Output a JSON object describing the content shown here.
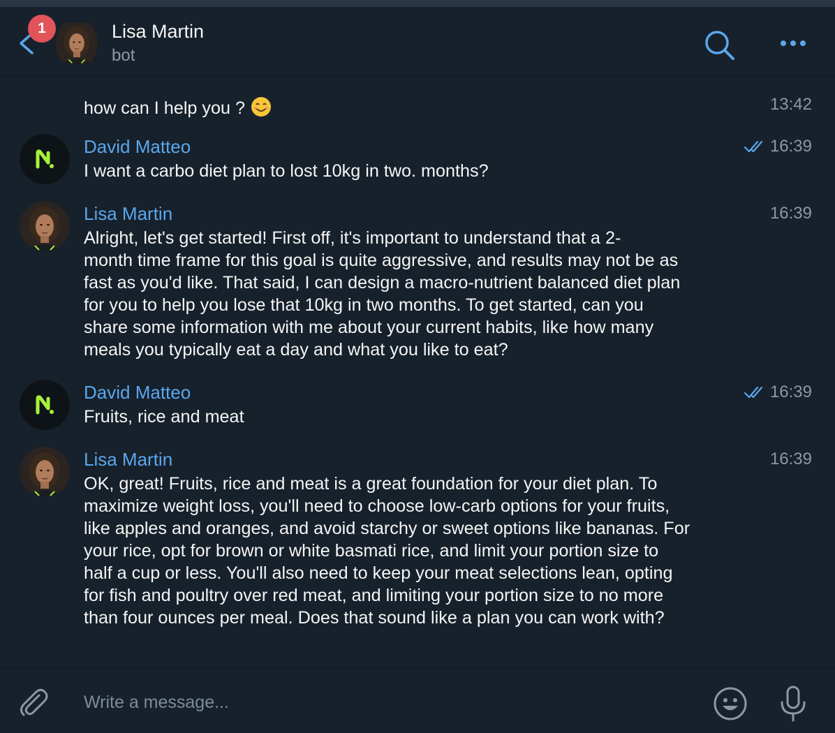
{
  "header": {
    "unread_count": "1",
    "title": "Lisa Martin",
    "subtitle": "bot"
  },
  "messages": [
    {
      "sender": "",
      "time": "13:42",
      "lines": [
        "how can I help you ?"
      ],
      "emoji": "smiling-face",
      "read": false
    },
    {
      "sender": "David Matteo",
      "time": "16:39",
      "read": true,
      "lines": [
        "I want a carbo diet plan to lost 10kg in two. months?"
      ]
    },
    {
      "sender": "Lisa Martin",
      "time": "16:39",
      "read": false,
      "lines": [
        "Alright, let's get started! First off, it's important to understand that a 2-",
        "month time frame for this goal is quite aggressive, and results may not be as",
        "fast as you'd like. That said, I can design a macro-nutrient balanced diet plan",
        "for you to help you lose that 10kg in two months. To get started, can you",
        "share some information with me about your current habits, like how many",
        "meals you typically eat a day and what you like to eat?"
      ]
    },
    {
      "sender": "David Matteo",
      "time": "16:39",
      "read": true,
      "lines": [
        "Fruits, rice and meat"
      ]
    },
    {
      "sender": "Lisa Martin",
      "time": "16:39",
      "read": false,
      "lines": [
        "OK, great! Fruits, rice and meat is a great foundation for your diet plan. To",
        "maximize weight loss, you'll need to choose low-carb options for your fruits,",
        "like apples and oranges, and avoid starchy or sweet options like bananas. For",
        "your rice, opt for brown or white basmati rice, and limit your portion size to",
        "half a cup or less. You'll also need to keep your meat selections lean, opting",
        "for fish and poultry over red meat, and limiting your portion size to no more",
        "than four ounces per meal. Does that sound like a plan you can work with?"
      ]
    }
  ],
  "composer": {
    "placeholder": "Write a message..."
  },
  "icons": {
    "back": "chevron-left-icon",
    "search": "search-icon",
    "more": "more-dots-icon",
    "attach": "paperclip-icon",
    "emoji": "emoji-icon",
    "mic": "microphone-icon",
    "read": "double-check-icon"
  },
  "colors": {
    "background": "#17212b",
    "accent": "#5aa7ee",
    "badge": "#e0545a",
    "brand_n": "#a6f23a",
    "muted": "#8b98a5"
  }
}
